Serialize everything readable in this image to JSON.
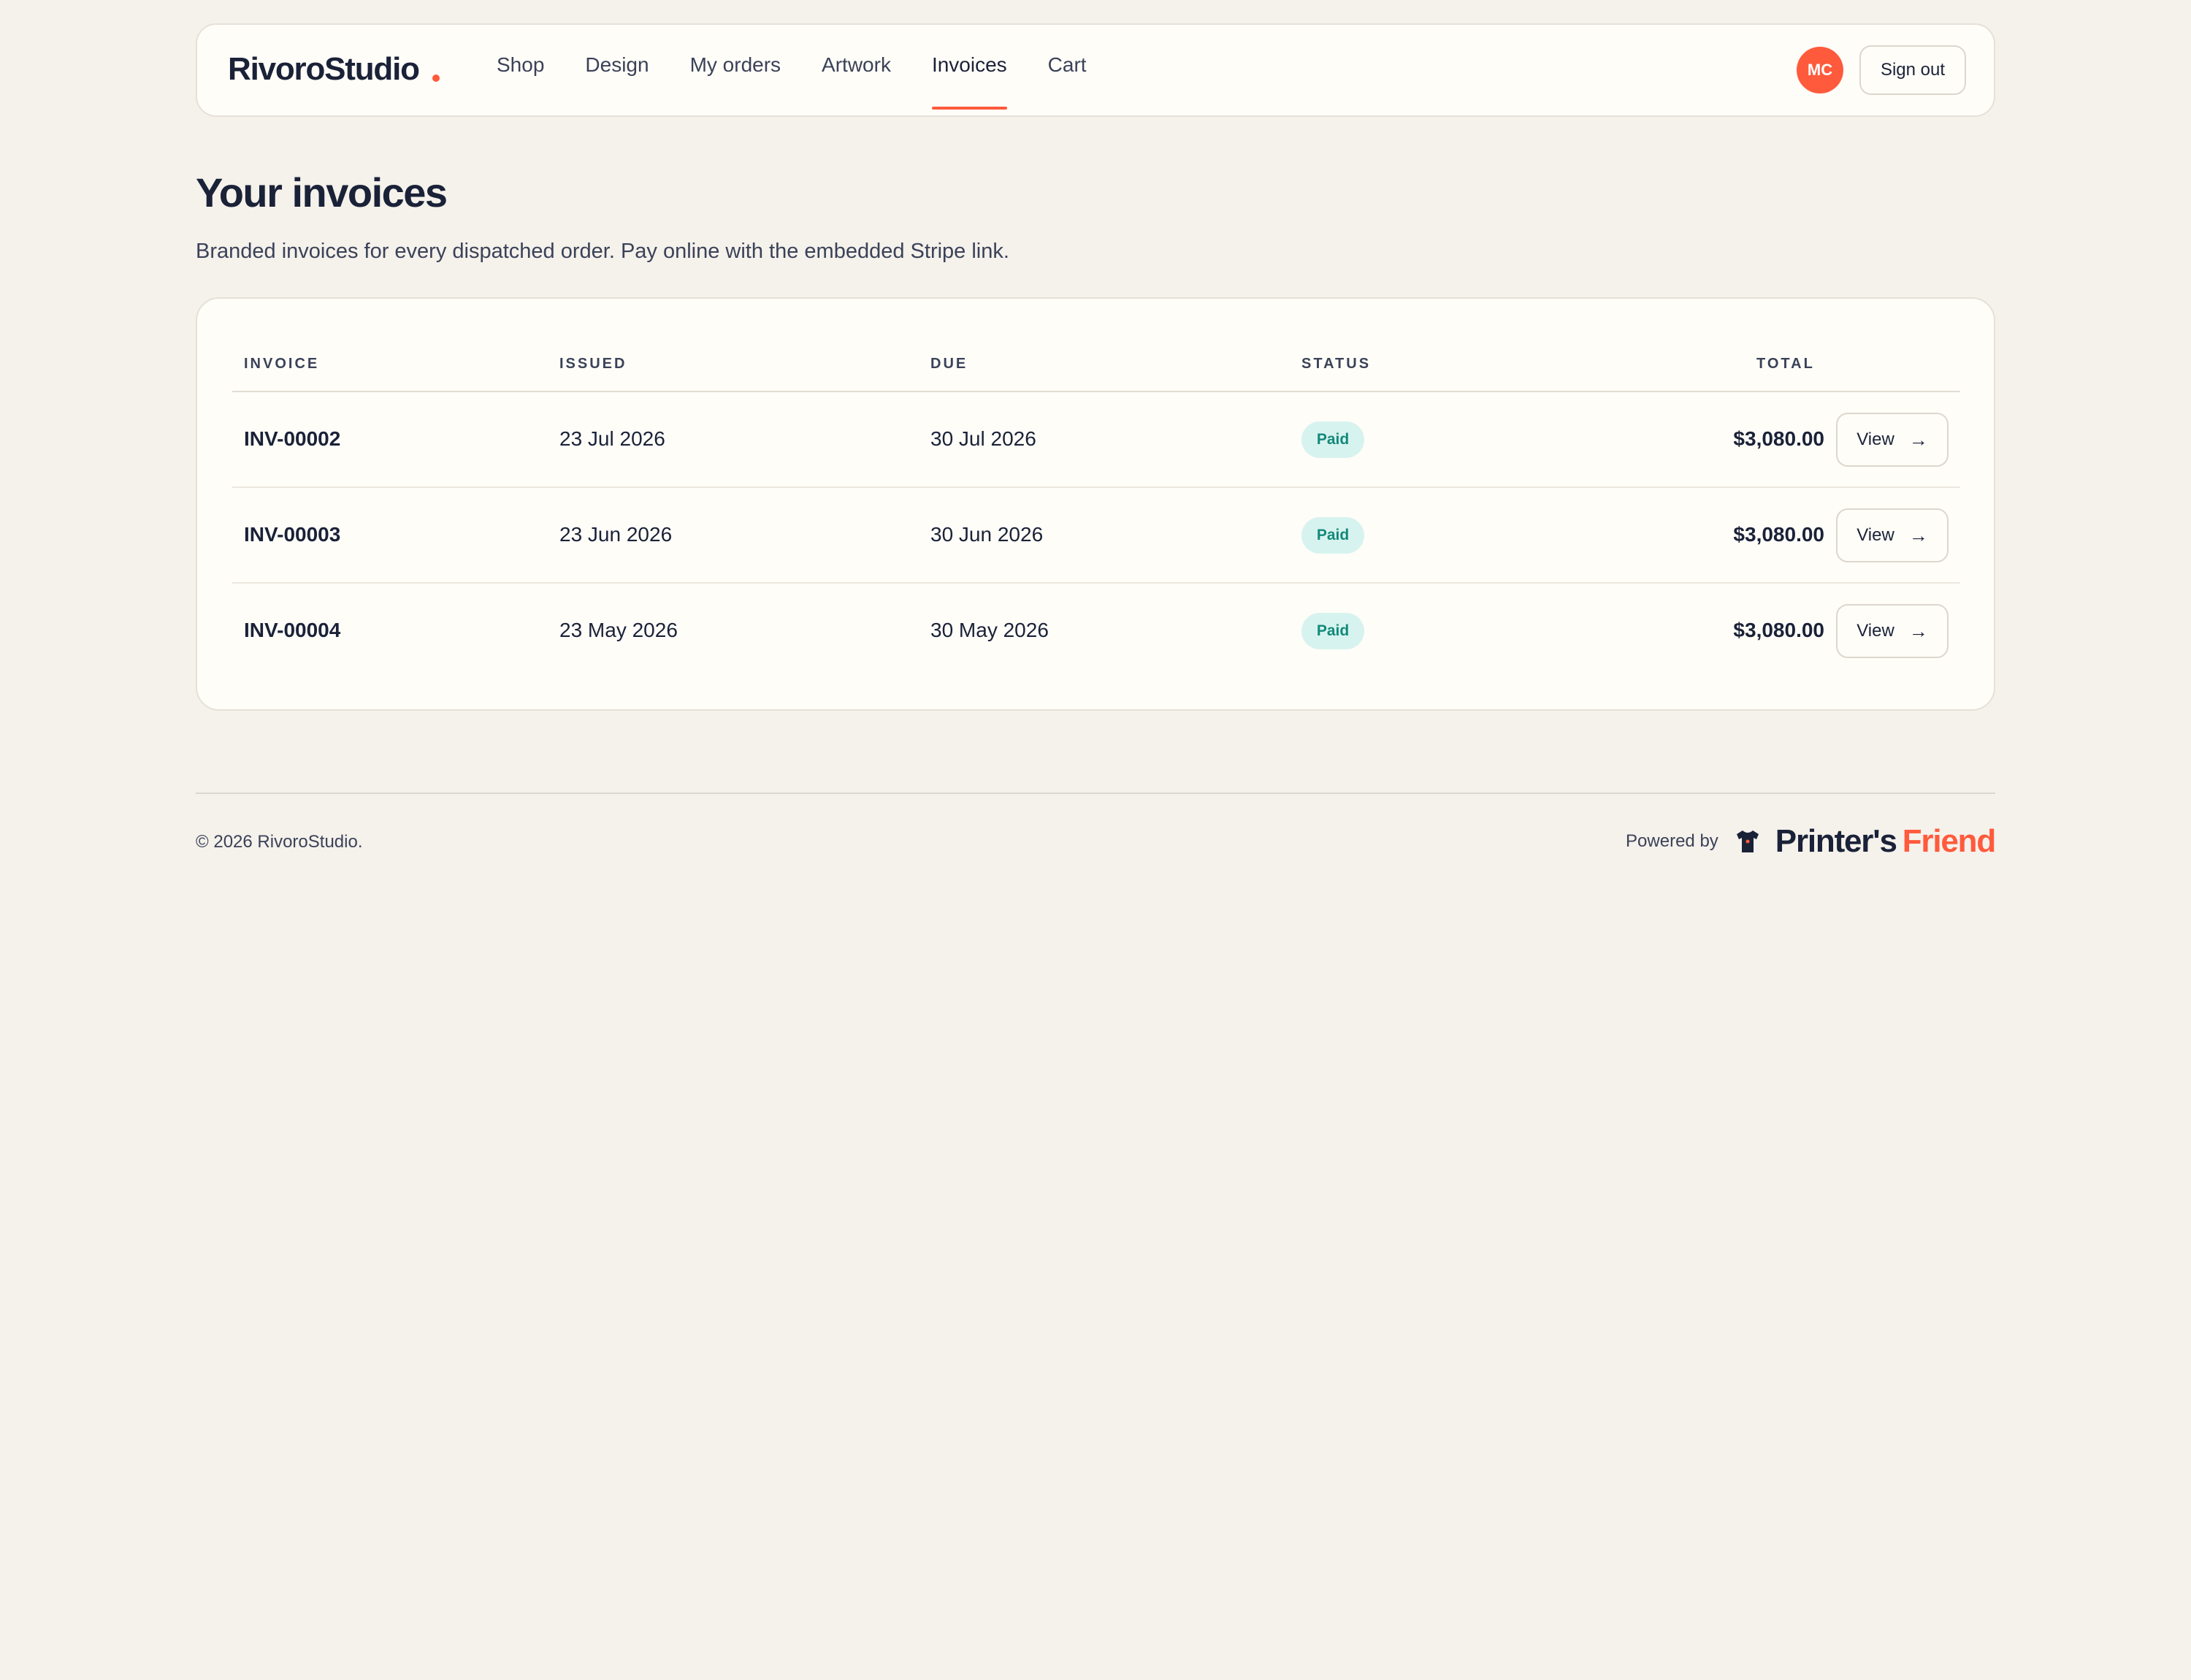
{
  "header": {
    "brand": "RivoroStudio",
    "nav": [
      {
        "label": "Shop",
        "active": false
      },
      {
        "label": "Design",
        "active": false
      },
      {
        "label": "My orders",
        "active": false
      },
      {
        "label": "Artwork",
        "active": false
      },
      {
        "label": "Invoices",
        "active": true
      },
      {
        "label": "Cart",
        "active": false
      }
    ],
    "avatar_initials": "MC",
    "signout_label": "Sign out"
  },
  "main": {
    "title": "Your invoices",
    "subtitle": "Branded invoices for every dispatched order. Pay online with the embedded Stripe link.",
    "table": {
      "columns": [
        "INVOICE",
        "ISSUED",
        "DUE",
        "STATUS",
        "TOTAL"
      ],
      "rows": [
        {
          "invoice": "INV-00002",
          "issued": "23 Jul 2026",
          "due": "30 Jul 2026",
          "status": "Paid",
          "total": "$3,080.00",
          "action": "View"
        },
        {
          "invoice": "INV-00003",
          "issued": "23 Jun 2026",
          "due": "30 Jun 2026",
          "status": "Paid",
          "total": "$3,080.00",
          "action": "View"
        },
        {
          "invoice": "INV-00004",
          "issued": "23 May 2026",
          "due": "30 May 2026",
          "status": "Paid",
          "total": "$3,080.00",
          "action": "View"
        }
      ]
    }
  },
  "footer": {
    "copyright": "© 2026 RivoroStudio.",
    "powered_by": "Powered by",
    "partner_name": "Printer's",
    "partner_accent": "Friend",
    "partner_icon": "tshirt-icon"
  },
  "colors": {
    "accent": "#ff5a3c",
    "text": "#1a2238",
    "background": "#f5f1eb",
    "paid_badge_bg": "#d7f3ef",
    "paid_badge_text": "#13897a"
  }
}
